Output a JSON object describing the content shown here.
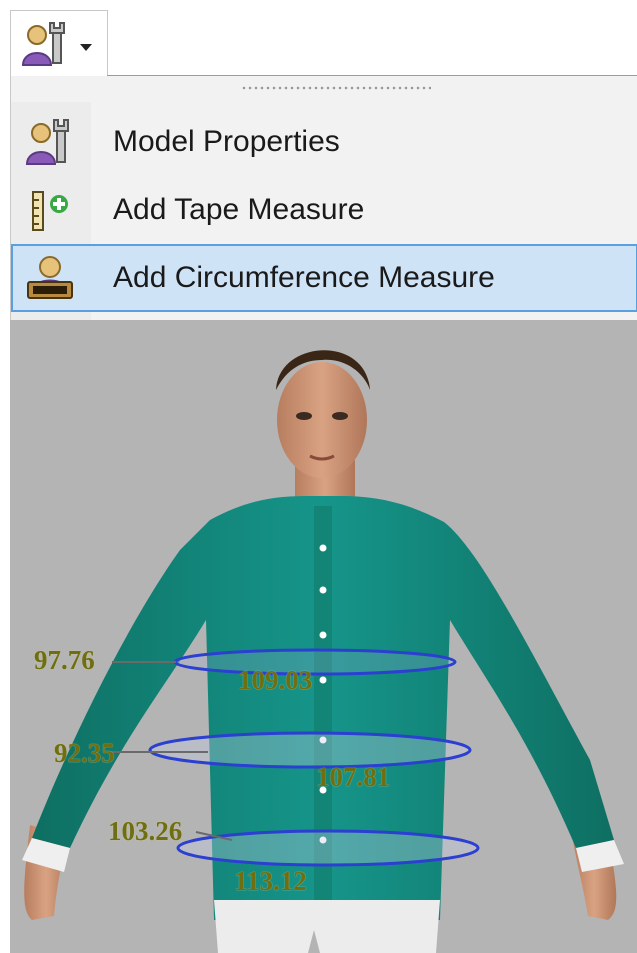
{
  "toolbar": {
    "icon": "user-wrench-icon",
    "caret": "chevron-down-icon"
  },
  "menu": {
    "items": [
      {
        "label": "Model Properties",
        "icon": "user-wrench-icon"
      },
      {
        "label": "Add Tape Measure",
        "icon": "tape-measure-add-icon"
      },
      {
        "label": "Add Circumference Measure",
        "icon": "circumference-measure-icon",
        "highlighted": true
      }
    ]
  },
  "viewport": {
    "measurements": [
      {
        "value": "97.76"
      },
      {
        "value": "109.03"
      },
      {
        "value": "92.35"
      },
      {
        "value": "107.81"
      },
      {
        "value": "103.26"
      },
      {
        "value": "113.12"
      }
    ]
  },
  "colors": {
    "menu_highlight": "#cfe3f6",
    "highlight_border": "#5aa0e0",
    "shirt": "#138b7c",
    "measure_text": "#6f6e10",
    "measure_ring": "#2b3fd0"
  }
}
